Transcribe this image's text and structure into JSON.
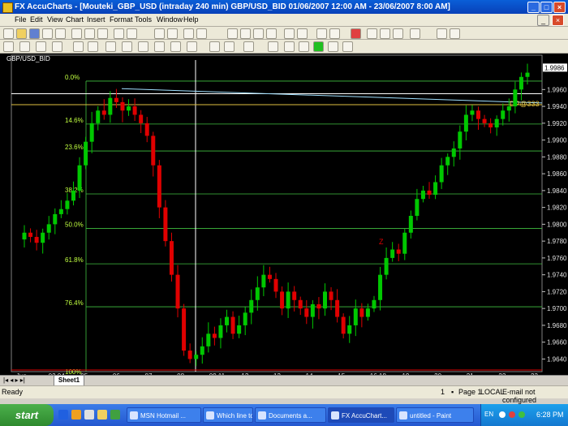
{
  "window": {
    "title": "FX AccuCharts - [Mouteki_GBP_USD (intraday 240 min)  GBP/USD_BID 01/06/2007 12:00 AM - 23/06/2007 8:00 AM]"
  },
  "menu": [
    "File",
    "Edit",
    "View",
    "Chart",
    "Insert",
    "Format",
    "Tools",
    "Window",
    "Help"
  ],
  "chart": {
    "instrument": "GBP/USD_BID",
    "dp_label": "DP@333",
    "current_price_label": "1.9986",
    "fib_levels": [
      {
        "label": "0.0%",
        "price": 1.997
      },
      {
        "label": "14.6%",
        "price": 1.9919
      },
      {
        "label": "23.6%",
        "price": 1.9887
      },
      {
        "label": "38.2%",
        "price": 1.9836
      },
      {
        "label": "50.0%",
        "price": 1.9795
      },
      {
        "label": "61.8%",
        "price": 1.9753
      },
      {
        "label": "76.4%",
        "price": 1.9702
      },
      {
        "label": "100%",
        "price": 1.962
      }
    ],
    "mark_label": "Z",
    "colors": {
      "up": "#00c800",
      "down": "#e00000",
      "fib": "#40c040",
      "background": "#000000",
      "hline": "#ffffff",
      "dp": "#e0c040"
    }
  },
  "chart_data": {
    "type": "candlestick",
    "ylim": [
      1.9625,
      1.9995
    ],
    "y_ticks": [
      "1.9960",
      "1.9940",
      "1.9920",
      "1.9900",
      "1.9880",
      "1.9860",
      "1.9840",
      "1.9820",
      "1.9800",
      "1.9780",
      "1.9760",
      "1.9740",
      "1.9720",
      "1.9700",
      "1.9680",
      "1.9660",
      "1.9640"
    ],
    "x_ticks": [
      "Jun",
      "02 04",
      "05",
      "06",
      "07",
      "08",
      "09 11",
      "12",
      "13",
      "14",
      "15",
      "16 18",
      "19",
      "20",
      "21",
      "22",
      "23"
    ],
    "closes": [
      1.979,
      1.9785,
      1.9778,
      1.979,
      1.98,
      1.9812,
      1.9818,
      1.9828,
      1.984,
      1.987,
      1.9898,
      1.992,
      1.9935,
      1.993,
      1.995,
      1.9945,
      1.9935,
      1.994,
      1.993,
      1.992,
      1.9905,
      1.987,
      1.982,
      1.978,
      1.974,
      1.97,
      1.965,
      1.964,
      1.9645,
      1.9655,
      1.967,
      1.9665,
      1.968,
      1.969,
      1.967,
      1.968,
      1.9695,
      1.971,
      1.9725,
      1.974,
      1.9735,
      1.972,
      1.97,
      1.972,
      1.971,
      1.97,
      1.969,
      1.9705,
      1.97,
      1.972,
      1.971,
      1.969,
      1.967,
      1.968,
      1.97,
      1.969,
      1.97,
      1.971,
      1.974,
      1.976,
      1.977,
      1.9765,
      1.979,
      1.981,
      1.983,
      1.984,
      1.9835,
      1.985,
      1.987,
      1.988,
      1.989,
      1.991,
      1.993,
      1.9935,
      1.9925,
      1.992,
      1.9915,
      1.9925,
      1.9935,
      1.994,
      1.996,
      1.9975,
      1.998
    ]
  },
  "sheet_tab": "Sheet1",
  "status": {
    "left": "Ready",
    "num": "1",
    "page": "Page 1",
    "local": "LOCAL",
    "email": "E-mail not configured"
  },
  "taskbar": {
    "start_label": "start",
    "tasks": [
      "MSN Hotmail ...",
      "Which line to ...",
      "Documents a...",
      "FX AccuChart...",
      "untitled - Paint"
    ],
    "lang": "EN",
    "clock": "6:28 PM"
  }
}
